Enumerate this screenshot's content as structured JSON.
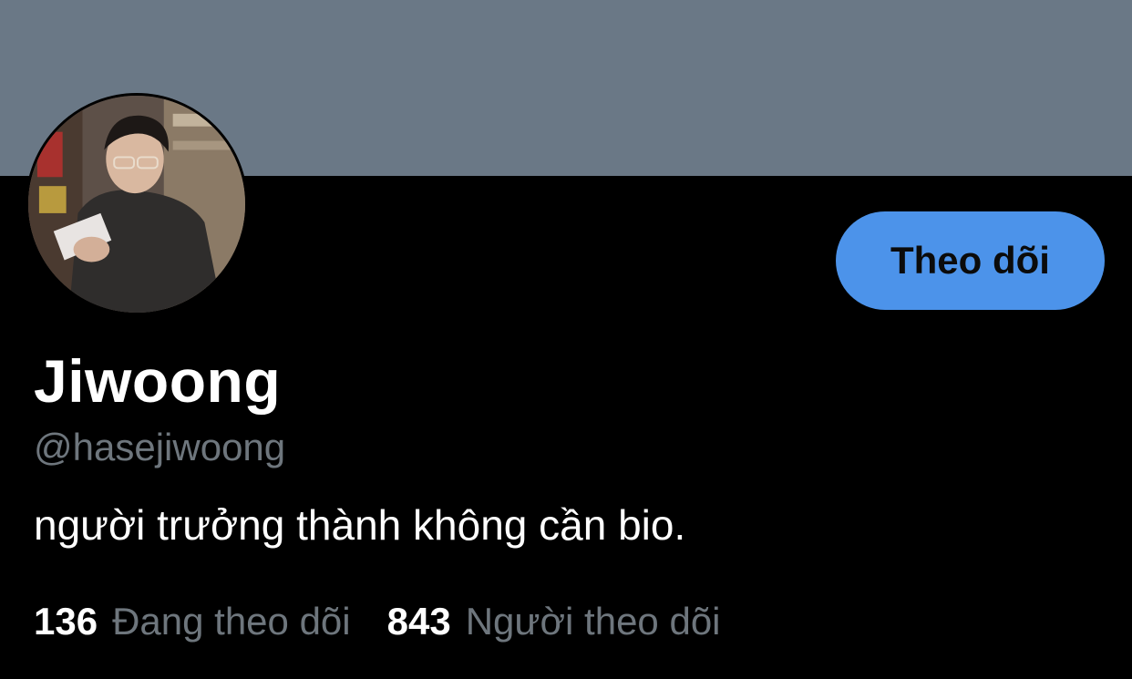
{
  "colors": {
    "banner": "#6a7886",
    "background": "#000000",
    "accent": "#4c93ea",
    "secondary_text": "#6e767d",
    "primary_text": "#ffffff"
  },
  "profile": {
    "display_name": "Jiwoong",
    "handle": "@hasejiwoong",
    "bio": "người trưởng thành không cần bio.",
    "avatar_icon": "profile-photo"
  },
  "actions": {
    "follow_label": "Theo dõi"
  },
  "stats": {
    "following_count": "136",
    "following_label": "Đang theo dõi",
    "followers_count": "843",
    "followers_label": "Người theo dõi"
  }
}
